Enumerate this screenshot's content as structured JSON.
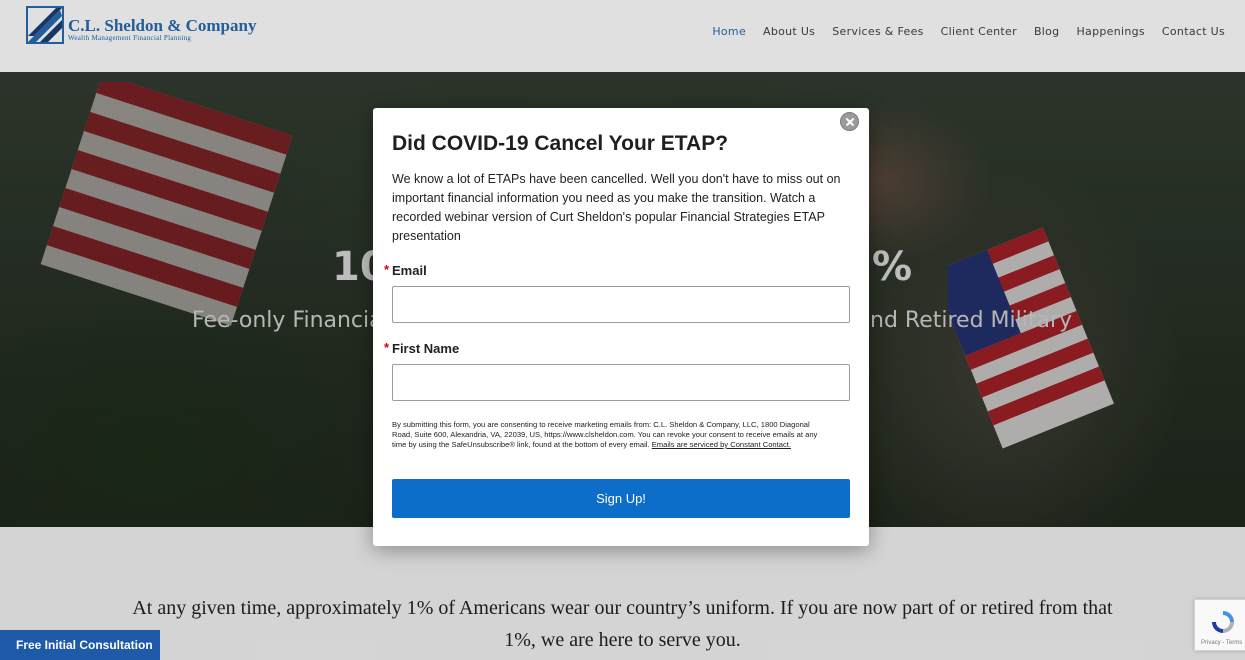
{
  "header": {
    "logo_name": "C.L. Sheldon & Company",
    "logo_tagline": "Wealth Management Financial Planning",
    "nav": [
      {
        "label": "Home",
        "active": true
      },
      {
        "label": "About Us"
      },
      {
        "label": "Services & Fees"
      },
      {
        "label": "Client Center"
      },
      {
        "label": "Blog"
      },
      {
        "label": "Happenings"
      },
      {
        "label": "Contact Us"
      }
    ],
    "colors": {
      "brand": "#2a6bb0"
    }
  },
  "hero": {
    "heading_left": "10",
    "heading_right": "%",
    "subheading_left": "Fee-only Financial",
    "subheading_right": "nd Retired Military"
  },
  "modal": {
    "title": "Did COVID-19 Cancel Your ETAP?",
    "description": "We know a lot of ETAPs have been cancelled. Well you don't have to miss out on important financial information you need as you make the transition. Watch a recorded webinar version of Curt Sheldon's popular Financial Strategies ETAP presentation",
    "fields": [
      {
        "label": "Email",
        "required_marker": "*",
        "value": "",
        "placeholder": ""
      },
      {
        "label": "First Name",
        "required_marker": "*",
        "value": "",
        "placeholder": ""
      }
    ],
    "consent_text": "By submitting this form, you are consenting to receive marketing emails from: C.L. Sheldon & Company, LLC, 1800 Diagonal Road, Suite 600, Alexandria, VA, 22039, US, https://www.clsheldon.com. You can revoke your consent to receive emails at any time by using the SafeUnsubscribe® link, found at the bottom of every email.",
    "consent_link": "Emails are serviced by Constant Contact.",
    "submit_label": "Sign Up!",
    "close_icon": "close-icon",
    "colors": {
      "button": "#0d6ec9",
      "required": "#d0021b"
    }
  },
  "main": {
    "intro": "At any given time, approximately 1% of Americans wear our country’s uniform. If you are now part of or retired from that 1%, we are here to serve you."
  },
  "consultation_tab": {
    "label": "Free Initial Consultation",
    "color": "#1e5aa8"
  },
  "recaptcha": {
    "text": "Privacy - Terms"
  }
}
